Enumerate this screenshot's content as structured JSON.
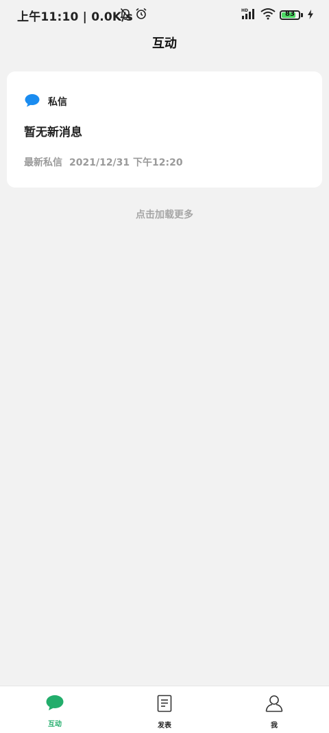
{
  "status_bar": {
    "time": "上午11:10",
    "separator": "|",
    "speed": "0.0K/s",
    "signal_label": "HD",
    "battery": "83",
    "battery_level": 0.83,
    "icons": [
      "bell-muted-icon",
      "alarm-icon",
      "signal-icon",
      "wifi-icon",
      "battery-icon",
      "charging-icon"
    ]
  },
  "header": {
    "title": "互动"
  },
  "card": {
    "title": "私信",
    "message": "暂无新消息",
    "latest_label": "最新私信",
    "latest_time": "2021/12/31 下午12:20",
    "icon_color": "#1a8cf0"
  },
  "load_more": "点击加载更多",
  "tabs": [
    {
      "label": "互动",
      "icon": "chat-bubble-icon",
      "active": true
    },
    {
      "label": "发表",
      "icon": "document-icon",
      "active": false
    },
    {
      "label": "我",
      "icon": "user-icon",
      "active": false
    }
  ],
  "colors": {
    "accent": "#22ad6b",
    "background": "#f2f2f2",
    "card": "#ffffff"
  }
}
